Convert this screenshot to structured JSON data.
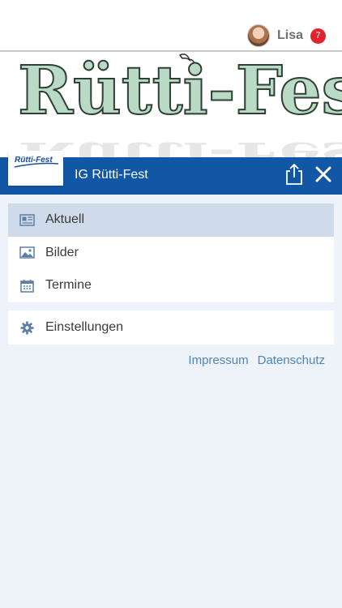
{
  "user": {
    "name": "Lisa",
    "badge": "7"
  },
  "banner": {
    "title": "Rütti-Fest"
  },
  "header": {
    "logo_text": "Rütti-Fest",
    "title": "IG Rütti-Fest"
  },
  "menu": {
    "items": [
      {
        "label": "Aktuell",
        "icon": "newspaper-icon",
        "active": true
      },
      {
        "label": "Bilder",
        "icon": "image-icon",
        "active": false
      },
      {
        "label": "Termine",
        "icon": "calendar-icon",
        "active": false
      }
    ]
  },
  "settings": {
    "label": "Einstellungen",
    "icon": "gear-icon"
  },
  "links": {
    "impressum": "Impressum",
    "datenschutz": "Datenschutz"
  },
  "colors": {
    "header": "#1257a6",
    "accent_link": "#4f86b8",
    "badge": "#e3232d",
    "active_item": "#cfdbea",
    "background": "#eef2f9",
    "banner_fill": "#b9dbc5"
  }
}
